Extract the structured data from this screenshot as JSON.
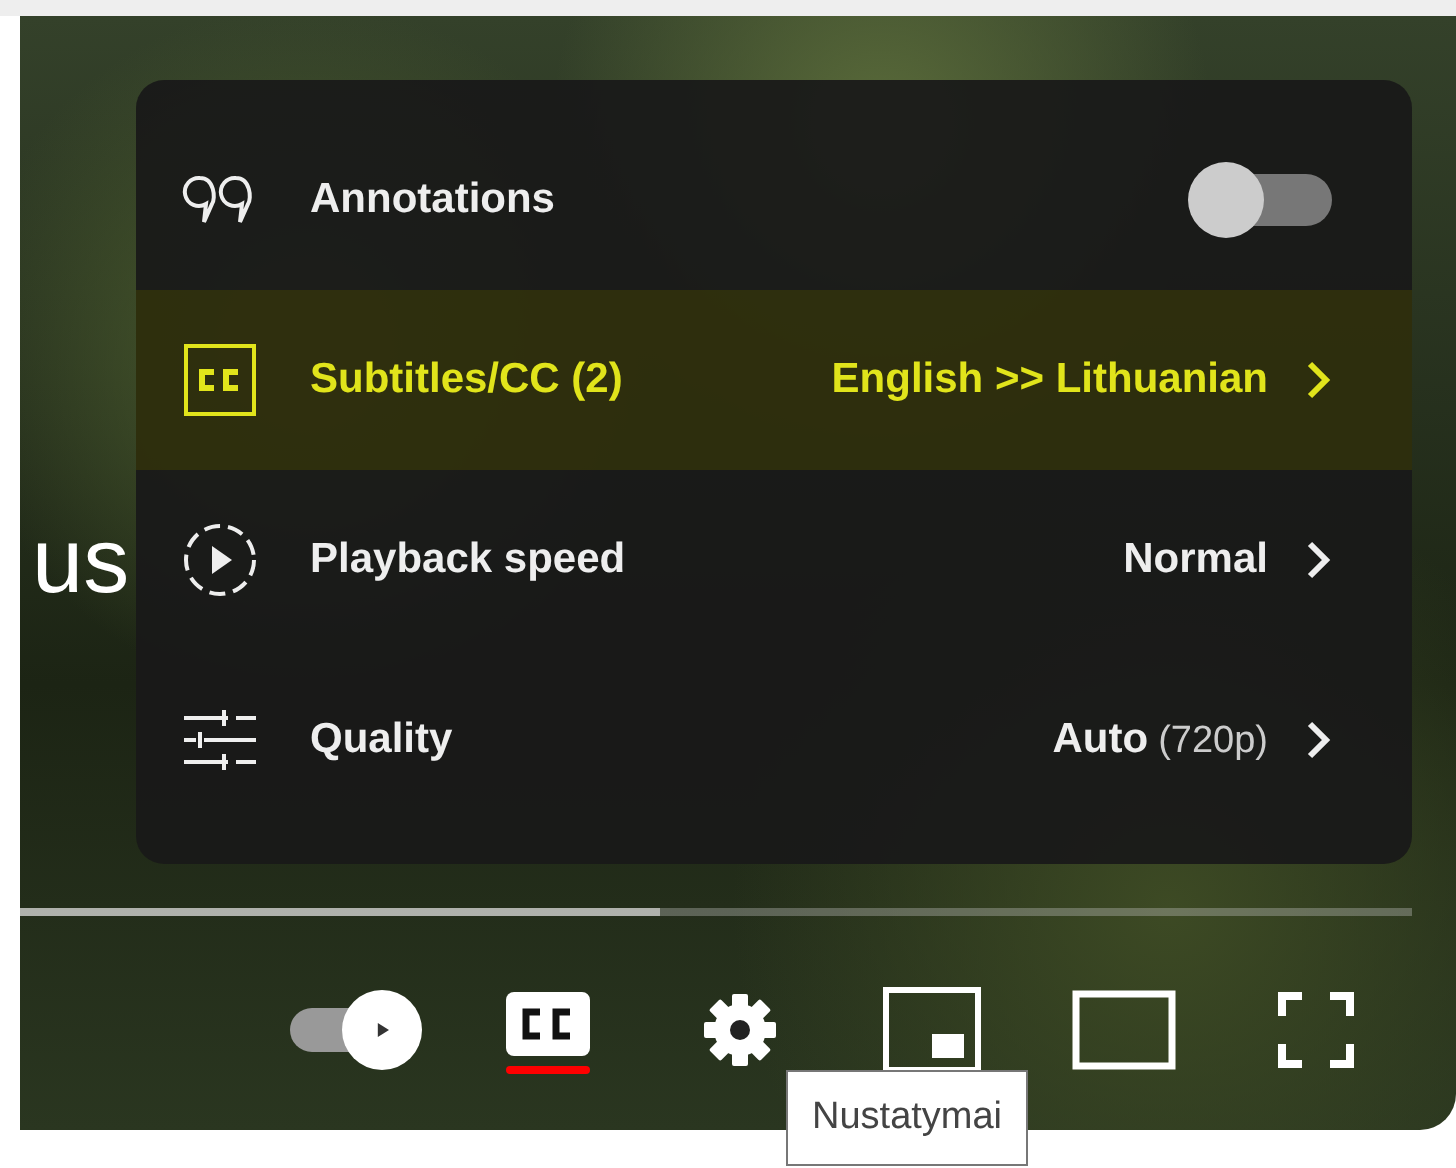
{
  "video": {
    "caption": "us",
    "settings_menu": [
      {
        "kind": "toggle",
        "label": "Annotations",
        "on": false,
        "highlighted": false
      },
      {
        "kind": "submenu",
        "label": "Subtitles/CC (2)",
        "value": "English >> Lithuanian",
        "highlighted": true
      },
      {
        "kind": "submenu",
        "label": "Playback speed",
        "value": "Normal",
        "highlighted": false
      },
      {
        "kind": "submenu",
        "label": "Quality",
        "value": "Auto",
        "value_note": "(720p)",
        "highlighted": false
      }
    ],
    "progress": {
      "level": 0.46
    },
    "controls": [
      {
        "kind": "autoplay",
        "on": true
      },
      {
        "kind": "subtitles",
        "on": true
      },
      {
        "kind": "settings"
      },
      {
        "kind": "miniplayer"
      },
      {
        "kind": "theater"
      },
      {
        "kind": "fullscreen"
      }
    ]
  },
  "tooltip": "Nustatymai"
}
